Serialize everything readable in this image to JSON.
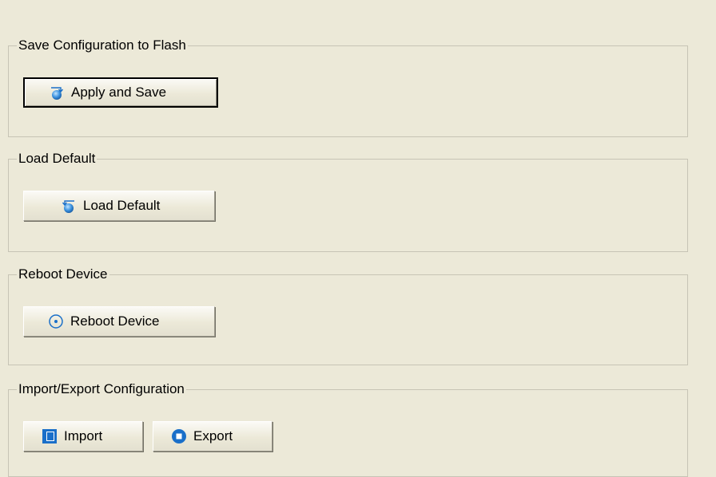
{
  "groups": {
    "save": {
      "title": "Save Configuration to Flash",
      "button_label": "Apply and Save",
      "icon": "apply-save-icon"
    },
    "load": {
      "title": "Load Default",
      "button_label": "Load Default",
      "icon": "load-default-icon"
    },
    "reboot": {
      "title": "Reboot Device",
      "button_label": "Reboot Device",
      "icon": "reboot-icon"
    },
    "import_export": {
      "title": "Import/Export Configuration",
      "import_label": "Import",
      "export_label": "Export",
      "import_icon": "import-icon",
      "export_icon": "export-icon"
    }
  },
  "colors": {
    "background": "#ece9d8",
    "group_border": "#c7c4b5",
    "icon_blue": "#1a6fc9"
  }
}
